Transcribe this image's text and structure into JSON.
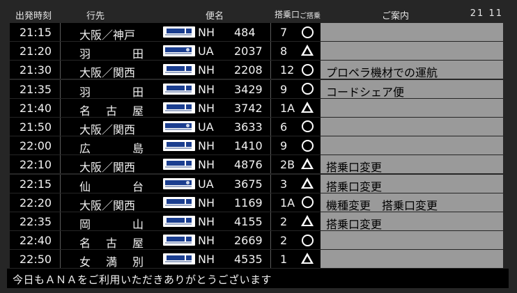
{
  "header": {
    "time": "出発時刻",
    "destination": "行先",
    "flight": "便名",
    "gate": "搭乗口",
    "boarding": "ご搭乗",
    "info": "ご案内",
    "clock": "21 11"
  },
  "flights": [
    {
      "time": "21:15",
      "dest": "大阪／神戸",
      "dest_chars": [],
      "logo": "ana",
      "airline": "NH",
      "number": "484",
      "gate": "7",
      "mark": "circle",
      "info": ""
    },
    {
      "time": "21:20",
      "dest": "羽田",
      "dest_chars": [
        "羽",
        "田"
      ],
      "logo": "ua",
      "airline": "UA",
      "number": "2037",
      "gate": "8",
      "mark": "triangle",
      "info": ""
    },
    {
      "time": "21:30",
      "dest": "大阪／関西",
      "dest_chars": [],
      "logo": "ana",
      "airline": "NH",
      "number": "2208",
      "gate": "12",
      "mark": "circle",
      "info": "プロペラ機材での運航"
    },
    {
      "time": "21:35",
      "dest": "羽田",
      "dest_chars": [
        "羽",
        "田"
      ],
      "logo": "ana",
      "airline": "NH",
      "number": "3429",
      "gate": "9",
      "mark": "circle",
      "info": "コードシェア便"
    },
    {
      "time": "21:40",
      "dest": "名古屋",
      "dest_chars": [
        "名",
        "古",
        "屋"
      ],
      "logo": "ana",
      "airline": "NH",
      "number": "3742",
      "gate": "1A",
      "mark": "triangle",
      "info": ""
    },
    {
      "time": "21:50",
      "dest": "大阪／関西",
      "dest_chars": [],
      "logo": "ua",
      "airline": "UA",
      "number": "3633",
      "gate": "6",
      "mark": "circle",
      "info": ""
    },
    {
      "time": "22:00",
      "dest": "広島",
      "dest_chars": [
        "広",
        "島"
      ],
      "logo": "ana",
      "airline": "NH",
      "number": "1410",
      "gate": "9",
      "mark": "circle",
      "info": ""
    },
    {
      "time": "22:10",
      "dest": "大阪／関西",
      "dest_chars": [],
      "logo": "ana",
      "airline": "NH",
      "number": "4876",
      "gate": "2B",
      "mark": "triangle",
      "info": "搭乗口変更"
    },
    {
      "time": "22:15",
      "dest": "仙台",
      "dest_chars": [
        "仙",
        "台"
      ],
      "logo": "ua",
      "airline": "UA",
      "number": "3675",
      "gate": "3",
      "mark": "triangle",
      "info": "搭乗口変更"
    },
    {
      "time": "22:20",
      "dest": "大阪／関西",
      "dest_chars": [],
      "logo": "ana",
      "airline": "NH",
      "number": "1169",
      "gate": "1A",
      "mark": "circle",
      "info": "機種変更　搭乗口変更"
    },
    {
      "time": "22:35",
      "dest": "岡山",
      "dest_chars": [
        "岡",
        "山"
      ],
      "logo": "ana",
      "airline": "NH",
      "number": "4155",
      "gate": "2",
      "mark": "triangle",
      "info": "搭乗口変更"
    },
    {
      "time": "22:40",
      "dest": "名古屋",
      "dest_chars": [
        "名",
        "古",
        "屋"
      ],
      "logo": "ana",
      "airline": "NH",
      "number": "2669",
      "gate": "2",
      "mark": "circle",
      "info": ""
    },
    {
      "time": "22:50",
      "dest": "女満別",
      "dest_chars": [
        "女",
        "満",
        "別"
      ],
      "logo": "ana",
      "airline": "NH",
      "number": "4535",
      "gate": "1",
      "mark": "triangle",
      "info": ""
    }
  ],
  "ticker": "今日もＡＮＡをご利用いただきありがとうございます",
  "colors": {
    "row_bg": "#000000",
    "info_bg": "#9a9a9a",
    "board_bg": "#262626",
    "text": "#f2f2f2"
  }
}
